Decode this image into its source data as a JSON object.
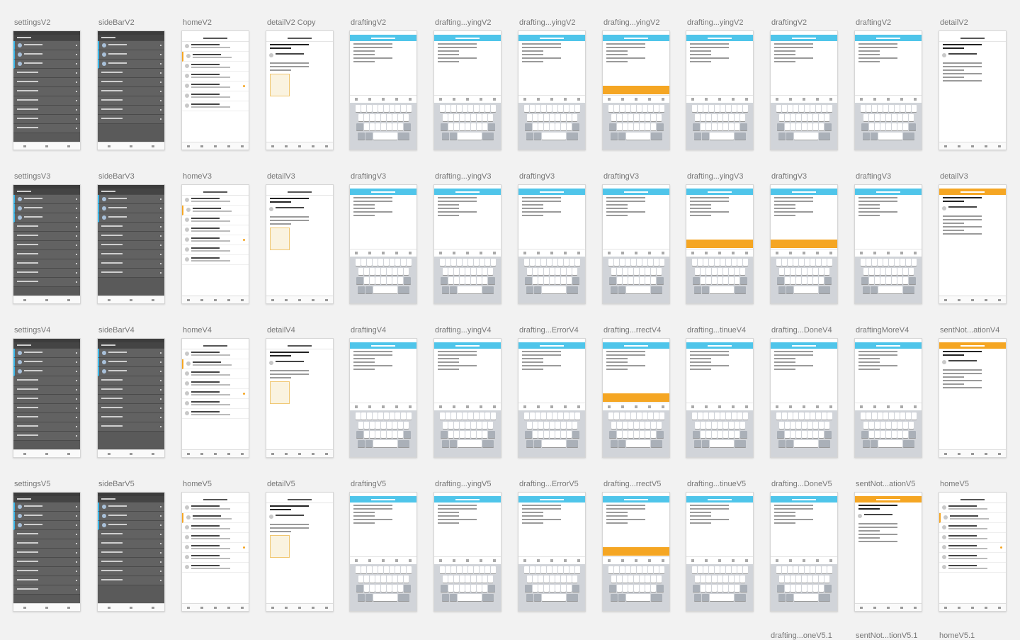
{
  "rows": [
    [
      "settingsV2",
      "sideBarV2",
      "homeV2",
      "detailV2 Copy",
      "draftingV2",
      "drafting...yingV2",
      "drafting...yingV2",
      "drafting...yingV2",
      "drafting...yingV2",
      "draftingV2",
      "draftingV2",
      "detailV2"
    ],
    [
      "settingsV3",
      "sideBarV3",
      "homeV3",
      "detailV3",
      "draftingV3",
      "drafting...yingV3",
      "draftingV3",
      "draftingV3",
      "drafting...yingV3",
      "draftingV3",
      "draftingV3",
      "detailV3"
    ],
    [
      "settingsV4",
      "sideBarV4",
      "homeV4",
      "detailV4",
      "draftingV4",
      "drafting...yingV4",
      "drafting...ErrorV4",
      "drafting...rrectV4",
      "drafting...tinueV4",
      "drafting...DoneV4",
      "draftingMoreV4",
      "sentNot...ationV4"
    ],
    [
      "settingsV5",
      "sideBarV5",
      "homeV5",
      "detailV5",
      "draftingV5",
      "drafting...yingV5",
      "drafting...ErrorV5",
      "drafting...rrectV5",
      "drafting...tinueV5",
      "drafting...DoneV5",
      "sentNot...ationV5",
      "homeV5"
    ]
  ],
  "footer_labels": [
    "drafting...oneV5.1",
    "sentNot...tionV5.1",
    "homeV5.1"
  ],
  "colors": {
    "accent_blue": "#4fc5ea",
    "accent_orange": "#f5a623",
    "dark_panel": "#5a5a5a"
  }
}
